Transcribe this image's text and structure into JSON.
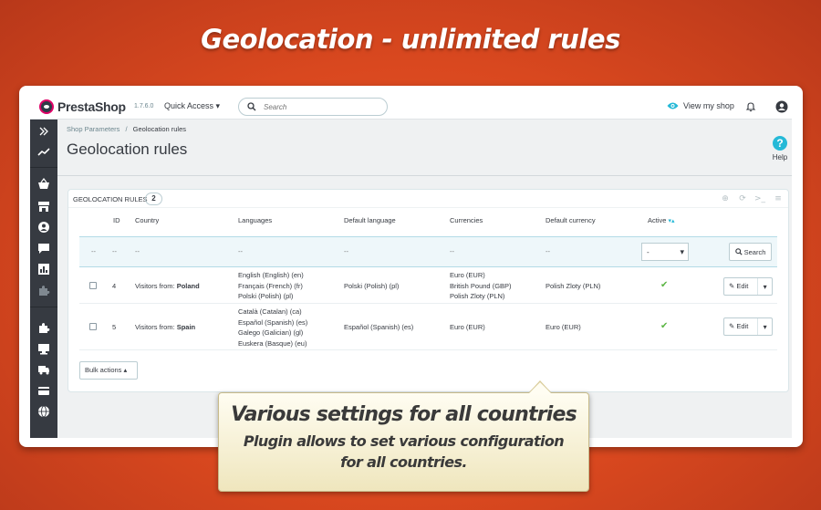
{
  "hero": {
    "title": "Geolocation - unlimited rules"
  },
  "topbar": {
    "brand": "PrestaShop",
    "version": "1.7.6.0",
    "quick_access": "Quick Access ▾",
    "search_placeholder": "Search",
    "view_shop": "View my shop"
  },
  "header": {
    "breadcrumb_parent": "Shop Parameters",
    "breadcrumb_sep": "/",
    "breadcrumb_current": "Geolocation rules",
    "title": "Geolocation rules",
    "help_label": "Help"
  },
  "panel": {
    "title": "Geolocation rules",
    "count": "2",
    "columns": [
      "ID",
      "Country",
      "Languages",
      "Default language",
      "Currencies",
      "Default currency",
      "Active"
    ],
    "filter_placeholder": "--",
    "filter_active": "-",
    "search_label": "Search",
    "rows": [
      {
        "id": "4",
        "country_prefix": "Visitors from:",
        "country": "Poland",
        "languages": [
          "English (English) (en)",
          "Français (French) (fr)",
          "Polski (Polish) (pl)"
        ],
        "default_language": "Polski (Polish) (pl)",
        "currencies": [
          "Euro (EUR)",
          "British Pound (GBP)",
          "Polish Zloty (PLN)"
        ],
        "default_currency": "Polish Zloty (PLN)",
        "active": true,
        "edit_label": "Edit"
      },
      {
        "id": "5",
        "country_prefix": "Visitors from:",
        "country": "Spain",
        "languages": [
          "Català (Catalan) (ca)",
          "Español (Spanish) (es)",
          "Galego (Galician) (gl)",
          "Euskera (Basque) (eu)"
        ],
        "default_language": "Español (Spanish) (es)",
        "currencies": [
          "Euro (EUR)"
        ],
        "default_currency": "Euro (EUR)",
        "active": true,
        "edit_label": "Edit"
      }
    ],
    "bulk_actions": "Bulk actions ▴"
  },
  "callout": {
    "title": "Various settings for all countries",
    "text": "Plugin allows to set various configuration for all countries."
  },
  "colors": {
    "accent": "#25b9d7",
    "sidebar": "#363a41",
    "background": "#d9481f",
    "success": "#5bb543"
  },
  "icons": [
    "expand-icon",
    "stats-icon",
    "orders-icon",
    "catalog-icon",
    "customers-icon",
    "messages-icon",
    "reports-icon",
    "modules-icon",
    "design-icon",
    "shipping-icon",
    "payment-icon",
    "international-icon"
  ]
}
